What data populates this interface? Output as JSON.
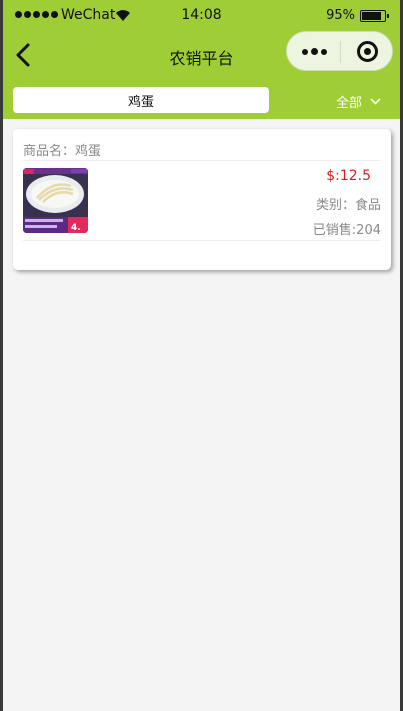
{
  "status_bar": {
    "carrier": "WeChat",
    "time": "14:08",
    "battery": "95%",
    "battery_level": 0.95
  },
  "nav": {
    "title": "农销平台"
  },
  "search": {
    "value": "鸡蛋"
  },
  "filter": {
    "label": "全部"
  },
  "product": {
    "name": "商品名：鸡蛋",
    "price": "$:12.5",
    "category": "类别：食品",
    "sold": "已销售:204"
  },
  "colors": {
    "header": "#9fcd35",
    "price": "#e21d1d"
  }
}
